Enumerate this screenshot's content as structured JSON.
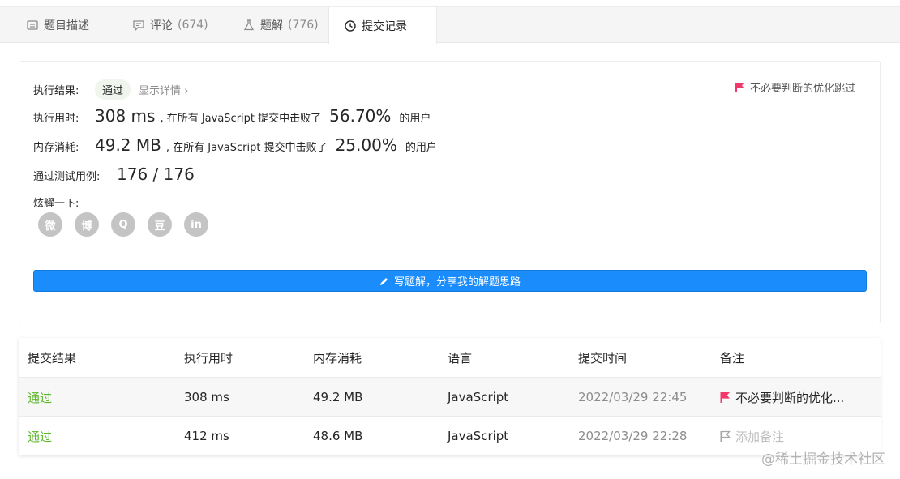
{
  "tabs": [
    {
      "label": "题目描述",
      "count": "",
      "icon": "description-icon"
    },
    {
      "label": "评论",
      "count": "(674)",
      "icon": "comment-icon"
    },
    {
      "label": "题解",
      "count": "(776)",
      "icon": "flask-icon"
    },
    {
      "label": "提交记录",
      "count": "",
      "icon": "clock-icon"
    }
  ],
  "result": {
    "label": "执行结果:",
    "status": "通过",
    "details_link": "显示详情 ›",
    "note": "不必要判断的优化跳过",
    "time_label": "执行用时:",
    "time_value": "308 ms",
    "time_mid": ", 在所有 JavaScript 提交中击败了",
    "time_pct": "56.70%",
    "time_suffix": "的用户",
    "mem_label": "内存消耗:",
    "mem_value": "49.2 MB",
    "mem_mid": ", 在所有 JavaScript 提交中击败了",
    "mem_pct": "25.00%",
    "mem_suffix": "的用户",
    "cases_label": "通过测试用例:",
    "cases_value": "176 / 176",
    "share_label": "炫耀一下:",
    "share_icons": [
      "wechat-icon",
      "weibo-icon",
      "qq-icon",
      "douban-icon",
      "linkedin-icon"
    ],
    "share_glyphs": [
      "微",
      "博",
      "Q",
      "豆",
      "in"
    ],
    "write_button": "写题解，分享我的解题思路"
  },
  "table": {
    "headers": [
      "提交结果",
      "执行用时",
      "内存消耗",
      "语言",
      "提交时间",
      "备注"
    ],
    "rows": [
      {
        "result": "通过",
        "time": "308 ms",
        "memory": "49.2 MB",
        "lang": "JavaScript",
        "submitted": "2022/03/29 22:45",
        "note": "不必要判断的优化..."
      },
      {
        "result": "通过",
        "time": "412 ms",
        "memory": "48.6 MB",
        "lang": "JavaScript",
        "submitted": "2022/03/29 22:28",
        "note": "添加备注"
      }
    ]
  },
  "watermark": "@稀土掘金技术社区",
  "colors": {
    "accent": "#1a8cfc",
    "pass": "#5cb82b",
    "flag": "#f0386b"
  }
}
